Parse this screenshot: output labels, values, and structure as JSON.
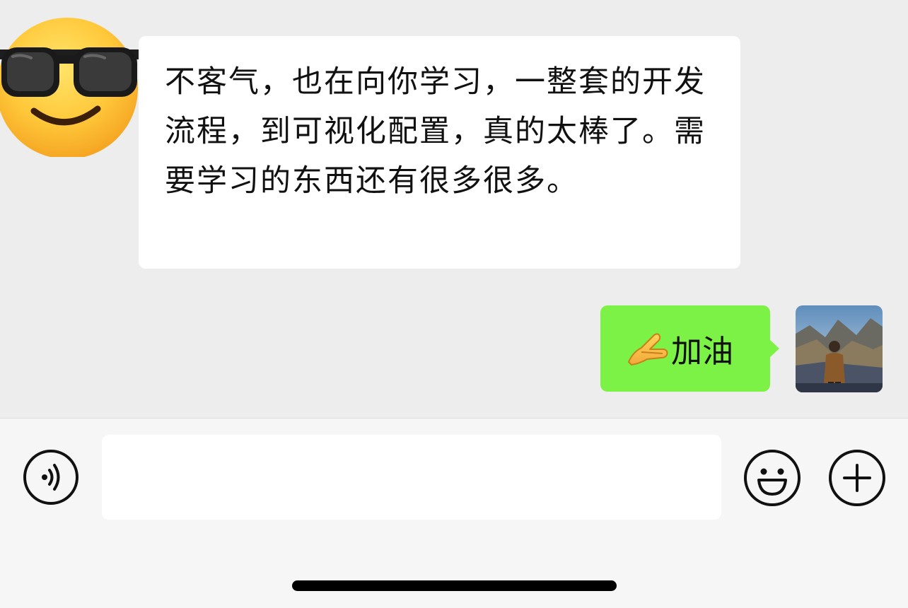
{
  "messages": [
    {
      "sender": "other",
      "avatar_icon": "sunglasses-emoji-icon",
      "text": "不客气，也在向你学习，一整套的开发流程，到可视化配置，真的太棒了。需要学习的东西还有很多很多。"
    },
    {
      "sender": "self",
      "avatar_icon": "user-photo-avatar",
      "emoji_icon": "pinching-hand-emoji-icon",
      "text": "加油"
    }
  ],
  "input_bar": {
    "voice_icon": "voice-icon",
    "input_value": "",
    "emoji_icon": "smile-icon",
    "more_icon": "plus-circle-icon"
  },
  "colors": {
    "chat_background": "#ededed",
    "bubble_self": "#7df246",
    "bubble_other": "#ffffff",
    "input_bar_background": "#f6f6f6"
  }
}
